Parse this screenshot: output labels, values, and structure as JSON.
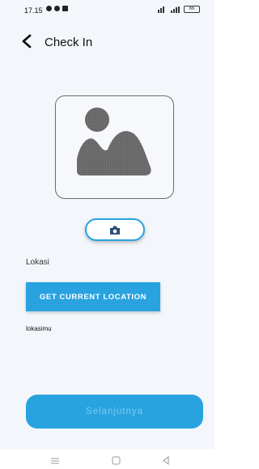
{
  "status_bar": {
    "time": "17.15",
    "battery": "66"
  },
  "app_bar": {
    "title": "Check In",
    "back_icon": "chevron-left-icon"
  },
  "photo": {
    "placeholder_icon": "image-placeholder-icon"
  },
  "camera_button": {
    "icon": "camera-icon"
  },
  "location": {
    "label": "Lokasi",
    "button_label": "GET CURRENT LOCATION",
    "value": "lokasimu"
  },
  "footer": {
    "next_label": "Selanjutnya"
  },
  "nav_bar": {
    "items": [
      "menu-icon",
      "home-icon",
      "back-icon"
    ]
  },
  "colors": {
    "accent": "#29a3e0",
    "background": "#f3f7fb",
    "disabled_text": "#7ac8ef"
  }
}
